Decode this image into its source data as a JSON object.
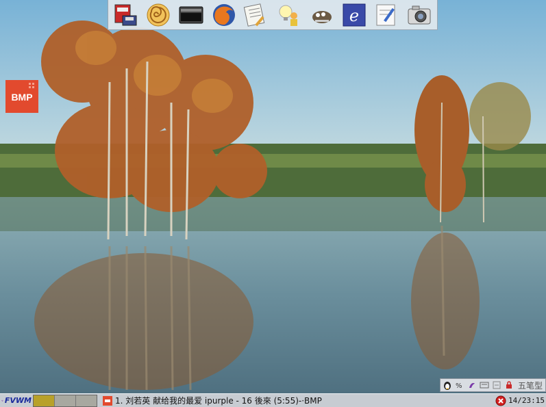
{
  "desktop": {
    "background": "cypress-trees-lake-wallpaper",
    "icons": [
      {
        "name": "bmp-image-icon",
        "label": "BMP"
      }
    ]
  },
  "launcher": {
    "buttons": [
      {
        "name": "system-settings-icon"
      },
      {
        "name": "nautilus-shell-icon"
      },
      {
        "name": "terminal-icon"
      },
      {
        "name": "firefox-icon"
      },
      {
        "name": "text-editor-icon"
      },
      {
        "name": "help-lightbulb-icon"
      },
      {
        "name": "gimp-icon"
      },
      {
        "name": "ie-browser-icon"
      },
      {
        "name": "writer-pen-icon"
      },
      {
        "name": "camera-icon"
      }
    ]
  },
  "ime": {
    "mode_label": "五笔型"
  },
  "taskbar": {
    "fvwm_label": "FVWM",
    "task_title": "1. 刘若英 献给我的最爱 ipurple - 16 後來 (5:55)-·BMP",
    "clock": "14/23:15"
  },
  "colors": {
    "taskbar": "#c7ccd2",
    "pager_active": "#b8a12a",
    "accent": "#1a2a9c"
  }
}
